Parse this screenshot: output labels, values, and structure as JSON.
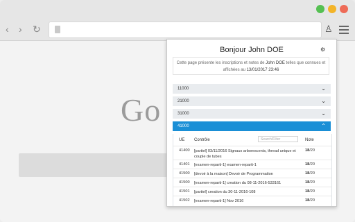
{
  "browser": {
    "nav_back": "‹",
    "nav_forward": "›",
    "reload": "↻",
    "ext_icon": "♙"
  },
  "page": {
    "logo_text": "Go"
  },
  "popup": {
    "title": "Bonjour John DOE",
    "settings_glyph": "⚙",
    "info_line1_pre": "Cette page présente les inscriptions et notes de ",
    "info_name": "John DOE",
    "info_line1_post": " telles que connues et",
    "info_line2_pre": "affichées au ",
    "info_date": "13/01/2017 23:46",
    "accordions": [
      {
        "label": "11000",
        "chevron": "⌄"
      },
      {
        "label": "21000",
        "chevron": "⌄"
      },
      {
        "label": "31000",
        "chevron": "⌄"
      },
      {
        "label": "41000",
        "chevron": "⌃"
      }
    ],
    "table": {
      "col_ue": "UE",
      "col_ctrl": "Contrôle",
      "filter_placeholder": "Search/Filter",
      "col_note": "Note",
      "rows": [
        {
          "ue": "41400",
          "ctrl": "[partiel] 03/11/2016 Signaux arborescents, thread unique et couple de tubes",
          "note": "18",
          "max": "/20"
        },
        {
          "ue": "41401",
          "ctrl": "[examen-reparti-1] examen-reparti-1",
          "note": "18",
          "max": "/20"
        },
        {
          "ue": "41500",
          "ctrl": "[devoir à la maison] Devoir de Programmation",
          "note": "18",
          "max": "/20"
        },
        {
          "ue": "41500",
          "ctrl": "[examen-reparti-1] creation du 08-11-2016-533161",
          "note": "18",
          "max": "/20"
        },
        {
          "ue": "41501",
          "ctrl": "[partiel] creation du 30-11-2016-108",
          "note": "18",
          "max": "/20"
        },
        {
          "ue": "41502",
          "ctrl": "[examen-reparti-1] Nov 2016",
          "note": "18",
          "max": "/20"
        }
      ]
    }
  }
}
